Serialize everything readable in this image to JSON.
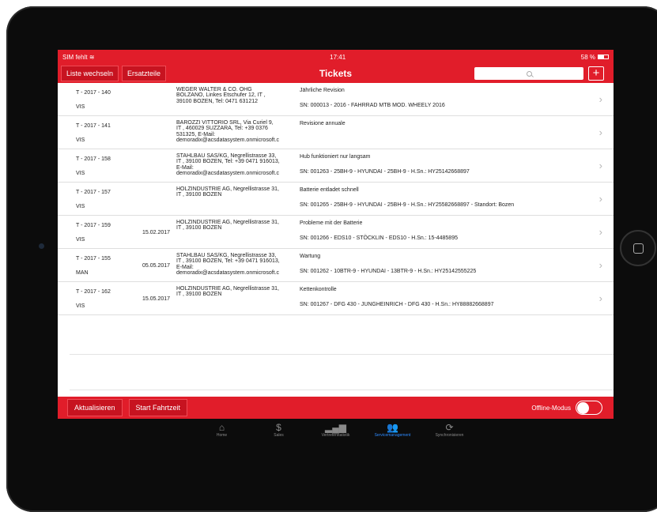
{
  "status": {
    "carrier": "SIM fehlt",
    "wifi": "wifi-icon",
    "time": "17:41",
    "battery": "58 %",
    "battery_fraction": 0.58
  },
  "nav": {
    "left_button": "Liste wechseln",
    "left_button2": "Ersatzteile",
    "title": "Tickets",
    "search_placeholder": "",
    "add_icon": "plus-icon"
  },
  "tickets": [
    {
      "id": "T - 2017 - 140",
      "type": "VIS",
      "date": "",
      "customer": "WEGER WALTER & CO. OHG\nBOLZANO, Linkes Etschufer 12, IT ,\n39100 BOZEN, Tel: 0471 631212",
      "title": "Jährliche Revision",
      "sn": "SN: 000013 - 2016 - FAHRRAD MTB MOD. WHEELY 2016"
    },
    {
      "id": "T - 2017 - 141",
      "type": "VIS",
      "date": "",
      "customer": "BAROZZI VITTORIO SRL, Via Curiel 9,\nIT , 460029 SUZZARA, Tel: +39 0376\n531325, E-Mail:\ndemoradix@acsdatasystem.onmicrosoft.c",
      "title": "Revisione annuale",
      "sn": ""
    },
    {
      "id": "T - 2017 - 158",
      "type": "VIS",
      "date": "",
      "customer": "STAHLBAU SAS/KG, Negrellistrasse 33,\nIT , 39100 BOZEN, Tel: +39 0471 916013,\nE-Mail:\ndemoradix@acsdatasystem.onmicrosoft.c",
      "title": "Hub funktioniert nur langsam",
      "sn": "SN: 001263 - 25BH-9 - HYUNDAI - 25BH-9 - H.Sn.: HY25142668897"
    },
    {
      "id": "T - 2017 - 157",
      "type": "VIS",
      "date": "",
      "customer": "HOLZINDUSTRIE AG, Negrellistrasse 31,\nIT , 39100 BOZEN",
      "title": "Batterie entladet schnell",
      "sn": "SN: 001265 - 25BH-9 - HYUNDAI - 25BH-9 - H.Sn.: HY25582668897 - Standort: Bozen"
    },
    {
      "id": "T - 2017 - 159",
      "type": "VIS",
      "date": "15.02.2017",
      "customer": "HOLZINDUSTRIE AG, Negrellistrasse 31,\nIT , 39100 BOZEN",
      "title": "Probleme mit der Batterie",
      "sn": "SN: 001266 - EDS10 - STÖCKLIN - EDS10 - H.Sn.: 15-4485895"
    },
    {
      "id": "T - 2017 - 155",
      "type": "MAN",
      "date": "05.05.2017",
      "customer": "STAHLBAU SAS/KG, Negrellistrasse 33,\nIT , 39100 BOZEN, Tel: +39 0471 916013,\nE-Mail:\ndemoradix@acsdatasystem.onmicrosoft.c",
      "title": "Wartung",
      "sn": "SN: 001262 - 10BTR-9 - HYUNDAI - 13BTR-9 - H.Sn.: HY25142555225"
    },
    {
      "id": "T - 2017 - 162",
      "type": "VIS",
      "date": "15.05.2017",
      "customer": "HOLZINDUSTRIE AG, Negrellistrasse 31,\nIT , 39100 BOZEN",
      "title": "Kettenkontrolle",
      "sn": "SN: 001267 - DFG 430 - JUNGHEINRICH - DFG 430 - H.Sn.: HY88882668897"
    }
  ],
  "toolbar": {
    "refresh": "Aktualisieren",
    "start": "Start Fahrtzeit",
    "offline_label": "Offline-Modus",
    "offline_on": false
  },
  "tabs": [
    {
      "label": "Home",
      "icon": "home-icon",
      "glyph": "⌂",
      "active": false
    },
    {
      "label": "Sales",
      "icon": "dollar-icon",
      "glyph": "$",
      "active": false
    },
    {
      "label": "Vertreterstatistik",
      "icon": "bar-chart-icon",
      "glyph": "▂▄▆",
      "active": false
    },
    {
      "label": "Servicemanagement",
      "icon": "people-icon",
      "glyph": "👥",
      "active": true
    },
    {
      "label": "Synchronisieren",
      "icon": "sync-icon",
      "glyph": "⟳",
      "active": false
    }
  ],
  "colors": {
    "accent": "#e11d2a",
    "tab_active": "#2e8bff"
  }
}
